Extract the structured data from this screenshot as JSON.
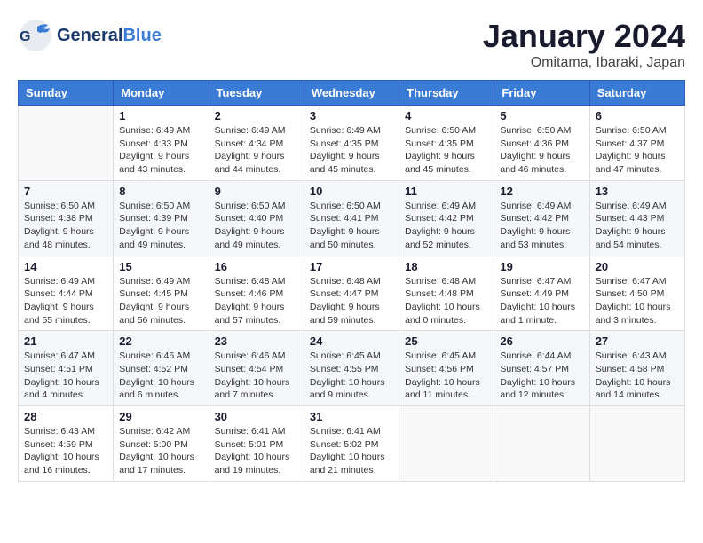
{
  "header": {
    "logo_general": "General",
    "logo_blue": "Blue",
    "month": "January 2024",
    "location": "Omitama, Ibaraki, Japan"
  },
  "weekdays": [
    "Sunday",
    "Monday",
    "Tuesday",
    "Wednesday",
    "Thursday",
    "Friday",
    "Saturday"
  ],
  "weeks": [
    [
      {
        "day": "",
        "sunrise": "",
        "sunset": "",
        "daylight": ""
      },
      {
        "day": "1",
        "sunrise": "Sunrise: 6:49 AM",
        "sunset": "Sunset: 4:33 PM",
        "daylight": "Daylight: 9 hours and 43 minutes."
      },
      {
        "day": "2",
        "sunrise": "Sunrise: 6:49 AM",
        "sunset": "Sunset: 4:34 PM",
        "daylight": "Daylight: 9 hours and 44 minutes."
      },
      {
        "day": "3",
        "sunrise": "Sunrise: 6:49 AM",
        "sunset": "Sunset: 4:35 PM",
        "daylight": "Daylight: 9 hours and 45 minutes."
      },
      {
        "day": "4",
        "sunrise": "Sunrise: 6:50 AM",
        "sunset": "Sunset: 4:35 PM",
        "daylight": "Daylight: 9 hours and 45 minutes."
      },
      {
        "day": "5",
        "sunrise": "Sunrise: 6:50 AM",
        "sunset": "Sunset: 4:36 PM",
        "daylight": "Daylight: 9 hours and 46 minutes."
      },
      {
        "day": "6",
        "sunrise": "Sunrise: 6:50 AM",
        "sunset": "Sunset: 4:37 PM",
        "daylight": "Daylight: 9 hours and 47 minutes."
      }
    ],
    [
      {
        "day": "7",
        "sunrise": "Sunrise: 6:50 AM",
        "sunset": "Sunset: 4:38 PM",
        "daylight": "Daylight: 9 hours and 48 minutes."
      },
      {
        "day": "8",
        "sunrise": "Sunrise: 6:50 AM",
        "sunset": "Sunset: 4:39 PM",
        "daylight": "Daylight: 9 hours and 49 minutes."
      },
      {
        "day": "9",
        "sunrise": "Sunrise: 6:50 AM",
        "sunset": "Sunset: 4:40 PM",
        "daylight": "Daylight: 9 hours and 49 minutes."
      },
      {
        "day": "10",
        "sunrise": "Sunrise: 6:50 AM",
        "sunset": "Sunset: 4:41 PM",
        "daylight": "Daylight: 9 hours and 50 minutes."
      },
      {
        "day": "11",
        "sunrise": "Sunrise: 6:49 AM",
        "sunset": "Sunset: 4:42 PM",
        "daylight": "Daylight: 9 hours and 52 minutes."
      },
      {
        "day": "12",
        "sunrise": "Sunrise: 6:49 AM",
        "sunset": "Sunset: 4:42 PM",
        "daylight": "Daylight: 9 hours and 53 minutes."
      },
      {
        "day": "13",
        "sunrise": "Sunrise: 6:49 AM",
        "sunset": "Sunset: 4:43 PM",
        "daylight": "Daylight: 9 hours and 54 minutes."
      }
    ],
    [
      {
        "day": "14",
        "sunrise": "Sunrise: 6:49 AM",
        "sunset": "Sunset: 4:44 PM",
        "daylight": "Daylight: 9 hours and 55 minutes."
      },
      {
        "day": "15",
        "sunrise": "Sunrise: 6:49 AM",
        "sunset": "Sunset: 4:45 PM",
        "daylight": "Daylight: 9 hours and 56 minutes."
      },
      {
        "day": "16",
        "sunrise": "Sunrise: 6:48 AM",
        "sunset": "Sunset: 4:46 PM",
        "daylight": "Daylight: 9 hours and 57 minutes."
      },
      {
        "day": "17",
        "sunrise": "Sunrise: 6:48 AM",
        "sunset": "Sunset: 4:47 PM",
        "daylight": "Daylight: 9 hours and 59 minutes."
      },
      {
        "day": "18",
        "sunrise": "Sunrise: 6:48 AM",
        "sunset": "Sunset: 4:48 PM",
        "daylight": "Daylight: 10 hours and 0 minutes."
      },
      {
        "day": "19",
        "sunrise": "Sunrise: 6:47 AM",
        "sunset": "Sunset: 4:49 PM",
        "daylight": "Daylight: 10 hours and 1 minute."
      },
      {
        "day": "20",
        "sunrise": "Sunrise: 6:47 AM",
        "sunset": "Sunset: 4:50 PM",
        "daylight": "Daylight: 10 hours and 3 minutes."
      }
    ],
    [
      {
        "day": "21",
        "sunrise": "Sunrise: 6:47 AM",
        "sunset": "Sunset: 4:51 PM",
        "daylight": "Daylight: 10 hours and 4 minutes."
      },
      {
        "day": "22",
        "sunrise": "Sunrise: 6:46 AM",
        "sunset": "Sunset: 4:52 PM",
        "daylight": "Daylight: 10 hours and 6 minutes."
      },
      {
        "day": "23",
        "sunrise": "Sunrise: 6:46 AM",
        "sunset": "Sunset: 4:54 PM",
        "daylight": "Daylight: 10 hours and 7 minutes."
      },
      {
        "day": "24",
        "sunrise": "Sunrise: 6:45 AM",
        "sunset": "Sunset: 4:55 PM",
        "daylight": "Daylight: 10 hours and 9 minutes."
      },
      {
        "day": "25",
        "sunrise": "Sunrise: 6:45 AM",
        "sunset": "Sunset: 4:56 PM",
        "daylight": "Daylight: 10 hours and 11 minutes."
      },
      {
        "day": "26",
        "sunrise": "Sunrise: 6:44 AM",
        "sunset": "Sunset: 4:57 PM",
        "daylight": "Daylight: 10 hours and 12 minutes."
      },
      {
        "day": "27",
        "sunrise": "Sunrise: 6:43 AM",
        "sunset": "Sunset: 4:58 PM",
        "daylight": "Daylight: 10 hours and 14 minutes."
      }
    ],
    [
      {
        "day": "28",
        "sunrise": "Sunrise: 6:43 AM",
        "sunset": "Sunset: 4:59 PM",
        "daylight": "Daylight: 10 hours and 16 minutes."
      },
      {
        "day": "29",
        "sunrise": "Sunrise: 6:42 AM",
        "sunset": "Sunset: 5:00 PM",
        "daylight": "Daylight: 10 hours and 17 minutes."
      },
      {
        "day": "30",
        "sunrise": "Sunrise: 6:41 AM",
        "sunset": "Sunset: 5:01 PM",
        "daylight": "Daylight: 10 hours and 19 minutes."
      },
      {
        "day": "31",
        "sunrise": "Sunrise: 6:41 AM",
        "sunset": "Sunset: 5:02 PM",
        "daylight": "Daylight: 10 hours and 21 minutes."
      },
      {
        "day": "",
        "sunrise": "",
        "sunset": "",
        "daylight": ""
      },
      {
        "day": "",
        "sunrise": "",
        "sunset": "",
        "daylight": ""
      },
      {
        "day": "",
        "sunrise": "",
        "sunset": "",
        "daylight": ""
      }
    ]
  ]
}
